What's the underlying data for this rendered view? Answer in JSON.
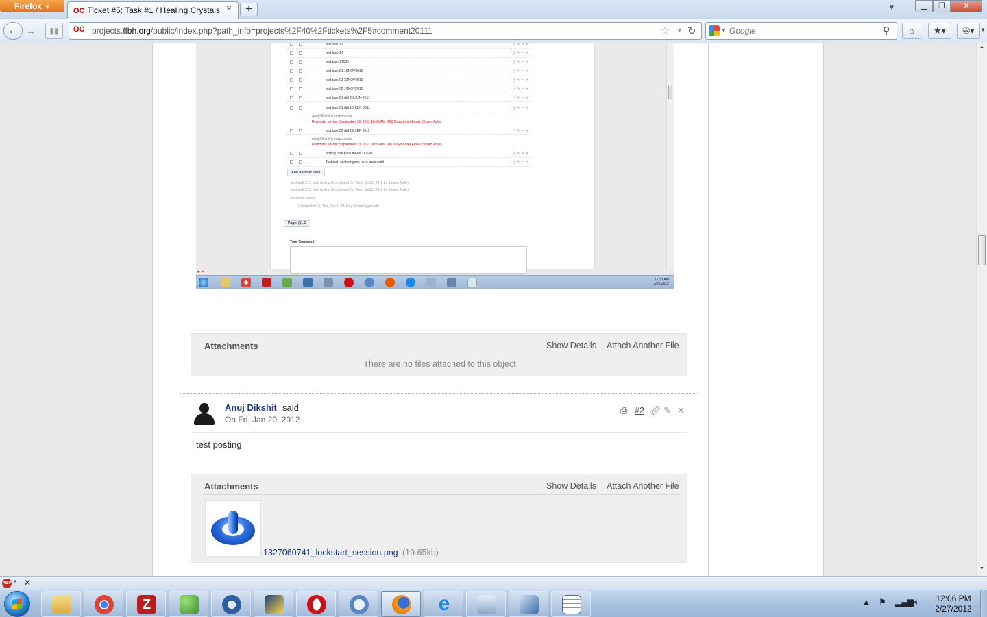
{
  "browser": {
    "menu_label": "Firefox",
    "tab_title": "Ticket #5: Task #1 / Healing Crystals",
    "url_host_prefix": "projects.",
    "url_host_domain": "ffbh.org",
    "url_path": "/public/index.php?path_info=projects%2F40%2Ftickets%2F5#comment20111",
    "search_placeholder": "Google"
  },
  "embedded_screenshot": {
    "task_rows": [
      "test task 13",
      "test task 14",
      "test task 14123",
      "test task 01 19NOV2010",
      "test task 01 22NOV2010",
      "test task 02 19NOV2010",
      "test task 01 dtd 23-JUN-2011",
      "test task 01 dtd 19-SEP-2011"
    ],
    "responsible_1": "Anuj Dikshit is responsible.",
    "reminder_1": "Reminder set for: September 19, 2011 10:50 AM (160 Days Late) Email: Shawn Adler",
    "task_row_9": "test task 02 dtd 19 SEP 2011",
    "responsible_2": "Anuj Dikshit is responsible.",
    "reminder_2": "Reminder set for: September 19, 2011 00:50 AM (160 Days Late) Email: Shawn Adler",
    "task_row_10": "testing task plain mode 112145",
    "task_row_11": "Test task content goes here. quick edit",
    "add_task_label": "Add Another Task",
    "completed": [
      "test task 213, edit, testing (Completed On Wed, Jul 13, 2011 by Shawn Adler)",
      "test task 212, edit, testing (Completed On Wed, Jul 13, 2011 by Shawn Adler)",
      "test task added",
      "(Completed On Tue, Jun 4, 2011 by Kavita Aggarwal)"
    ],
    "pages_label": "Page: (1), 2",
    "comment_label": "Your Comment*",
    "tray_time": "11:33 AM",
    "tray_date": "2/27/2012"
  },
  "attachments_1": {
    "title": "Attachments",
    "show_details": "Show Details",
    "attach_another": "Attach Another File",
    "empty_message": "There are no files attached to this object"
  },
  "comment": {
    "author": "Anuj Dikshit",
    "said": "said",
    "date": "On Fri, Jan 20. 2012",
    "number": "#2",
    "body": "test posting"
  },
  "attachments_2": {
    "title": "Attachments",
    "show_details": "Show Details",
    "attach_another": "Attach Another File",
    "file_name": "1327060741_lockstart_session.png",
    "file_size": "(19.65kb)"
  },
  "taskbar": {
    "time": "12:06 PM",
    "date": "2/27/2012",
    "colors": {
      "chrome": "#db4437",
      "filezilla": "#bf1d1d",
      "opera": "#cc0f16",
      "firefox": "#e66000",
      "ie": "#1e88e5"
    }
  }
}
